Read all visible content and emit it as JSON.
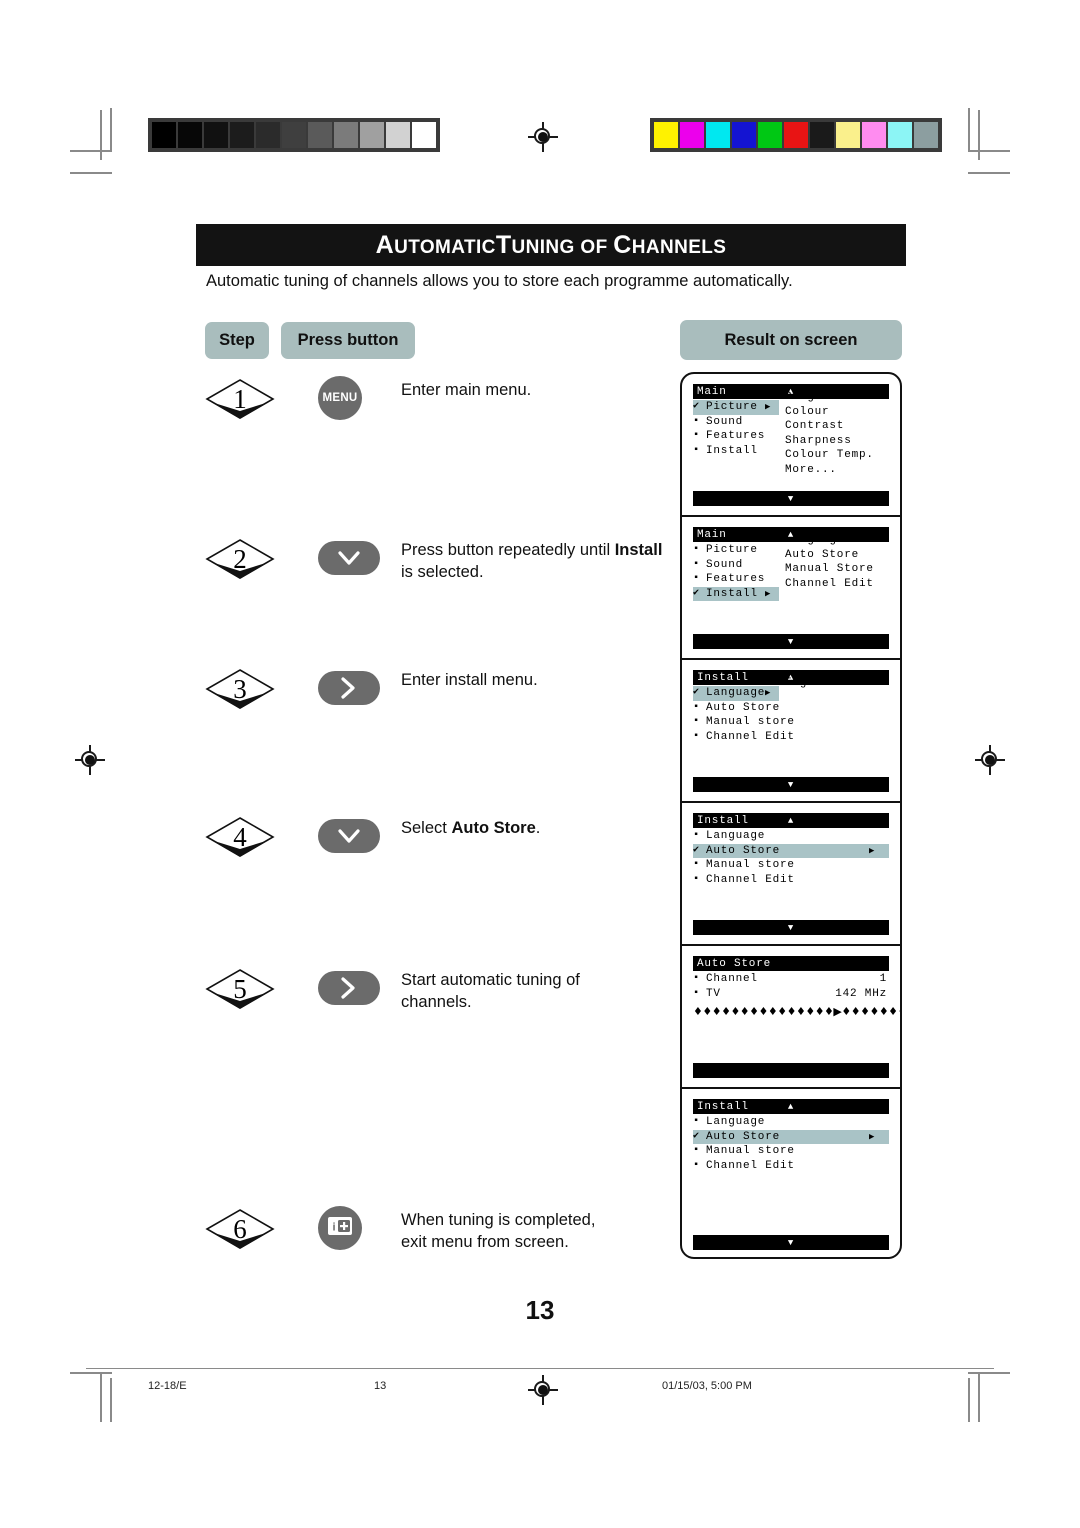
{
  "document": {
    "title_main": "AUTOMATIC TUNING OF CHANNELS",
    "title_parts": [
      "A",
      "UTOMATIC",
      "T",
      "UNING",
      " OF ",
      "C",
      "HANNELS"
    ],
    "intro": "Automatic tuning of channels allows you to store each programme automatically.",
    "page_number": "13"
  },
  "headers": {
    "step": "Step",
    "press_button": "Press button",
    "result": "Result on screen"
  },
  "steps": [
    {
      "number": "1",
      "button_kind": "menu",
      "button_label": "MENU",
      "text_plain": "Enter main menu.",
      "text_html": "Enter main menu."
    },
    {
      "number": "2",
      "button_kind": "chevron-down",
      "button_label": "",
      "text_plain": "Press button repeatedly until Install is selected.",
      "text_html": "Press button repeatedly until <b>Install</b> is selected."
    },
    {
      "number": "3",
      "button_kind": "chevron-right",
      "button_label": "",
      "text_plain": "Enter install menu.",
      "text_html": "Enter install menu."
    },
    {
      "number": "4",
      "button_kind": "chevron-down",
      "button_label": "",
      "text_plain": "Select Auto Store.",
      "text_html": "Select <b>Auto Store</b>."
    },
    {
      "number": "5",
      "button_kind": "chevron-right",
      "button_label": "",
      "text_plain": "Start automatic tuning of channels.",
      "text_html": "Start automatic tuning of<br>channels."
    },
    {
      "number": "6",
      "button_kind": "exit-info",
      "button_label": "",
      "text_plain": "When tuning is completed, exit menu from screen.",
      "text_html": "When tuning is completed,<br>exit menu from screen."
    }
  ],
  "screens": [
    {
      "title": "Main",
      "caret_up": "▲",
      "caret_down": "▼",
      "rows": [
        {
          "mark": "✔",
          "label": "Picture",
          "arrow": "▶",
          "highlight": true
        },
        {
          "mark": "▪",
          "label": "Sound",
          "arrow": "",
          "highlight": false
        },
        {
          "mark": "▪",
          "label": "Features",
          "arrow": "",
          "highlight": false
        },
        {
          "mark": "▪",
          "label": "Install",
          "arrow": "",
          "highlight": false
        }
      ],
      "column2": [
        "Brightness",
        "Colour",
        "Contrast",
        "Sharpness",
        "Colour Temp.",
        "More..."
      ]
    },
    {
      "title": "Main",
      "caret_up": "▲",
      "caret_down": "▼",
      "rows": [
        {
          "mark": "▪",
          "label": "Picture",
          "arrow": "",
          "highlight": false
        },
        {
          "mark": "▪",
          "label": "Sound",
          "arrow": "",
          "highlight": false
        },
        {
          "mark": "▪",
          "label": "Features",
          "arrow": "",
          "highlight": false
        },
        {
          "mark": "✔",
          "label": "Install",
          "arrow": "▶",
          "highlight": true
        }
      ],
      "column2": [
        "Language",
        "Auto Store",
        "Manual Store",
        "Channel Edit"
      ]
    },
    {
      "title": "Install",
      "caret_up": "▲",
      "caret_down": "▼",
      "rows": [
        {
          "mark": "✔",
          "label": "Language",
          "arrow": "▶",
          "highlight": true
        },
        {
          "mark": "▪",
          "label": "Auto Store",
          "arrow": "",
          "highlight": false
        },
        {
          "mark": "▪",
          "label": "Manual store",
          "arrow": "",
          "highlight": false
        },
        {
          "mark": "▪",
          "label": "Channel Edit",
          "arrow": "",
          "highlight": false
        }
      ],
      "column2": [
        "English"
      ]
    },
    {
      "title": "Install",
      "caret_up": "▲",
      "caret_down": "▼",
      "rows": [
        {
          "mark": "▪",
          "label": "Language",
          "arrow": "",
          "highlight": false
        },
        {
          "mark": "✔",
          "label": "Auto Store",
          "arrow": "▶",
          "highlight": true,
          "wide": true
        },
        {
          "mark": "▪",
          "label": "Manual store",
          "arrow": "",
          "highlight": false
        },
        {
          "mark": "▪",
          "label": "Channel Edit",
          "arrow": "",
          "highlight": false
        }
      ],
      "column2": []
    },
    {
      "title": "Auto Store",
      "caret_up": "",
      "caret_down": "",
      "rows": [
        {
          "mark": "▪",
          "label": "Channel",
          "value": "1",
          "highlight": false
        },
        {
          "mark": "▪",
          "label": "TV",
          "value": "142 MHz",
          "highlight": false
        }
      ],
      "column2": [],
      "progress": "♦♦♦♦♦♦♦♦♦♦♦♦♦♦♦▶♦♦♦♦♦♦♦♦♦♦♦♦♦♦♦♦",
      "progress_value": "47"
    },
    {
      "title": "Install",
      "caret_up": "▲",
      "caret_down": "▼",
      "rows": [
        {
          "mark": "▪",
          "label": "Language",
          "arrow": "",
          "highlight": false
        },
        {
          "mark": "✔",
          "label": "Auto Store",
          "arrow": "▶",
          "highlight": true,
          "wide": true
        },
        {
          "mark": "▪",
          "label": "Manual store",
          "arrow": "",
          "highlight": false
        },
        {
          "mark": "▪",
          "label": "Channel Edit",
          "arrow": "",
          "highlight": false
        }
      ],
      "column2": []
    }
  ],
  "footer": {
    "left": "12-18/E",
    "center": "13",
    "right": "01/15/03, 5:00 PM"
  },
  "calibration": {
    "grayscale": [
      "#000000",
      "#070707",
      "#111111",
      "#1c1c1c",
      "#2b2b2b",
      "#3f3f3f",
      "#5a5a5a",
      "#7b7b7b",
      "#a0a0a0",
      "#d2d2d2",
      "#ffffff"
    ],
    "colors": [
      "#fff200",
      "#ec00ec",
      "#00e8f0",
      "#1414d2",
      "#00c814",
      "#e81414",
      "#1a1a1a",
      "#faf08c",
      "#ff8cf0",
      "#8cf5f5",
      "#8c9ea0"
    ]
  },
  "colors": {
    "header_badge": "#a9bdbd",
    "osd_highlight": "#a9c3c6",
    "button_gray": "#6b6b6b",
    "title_bar": "#131313"
  }
}
